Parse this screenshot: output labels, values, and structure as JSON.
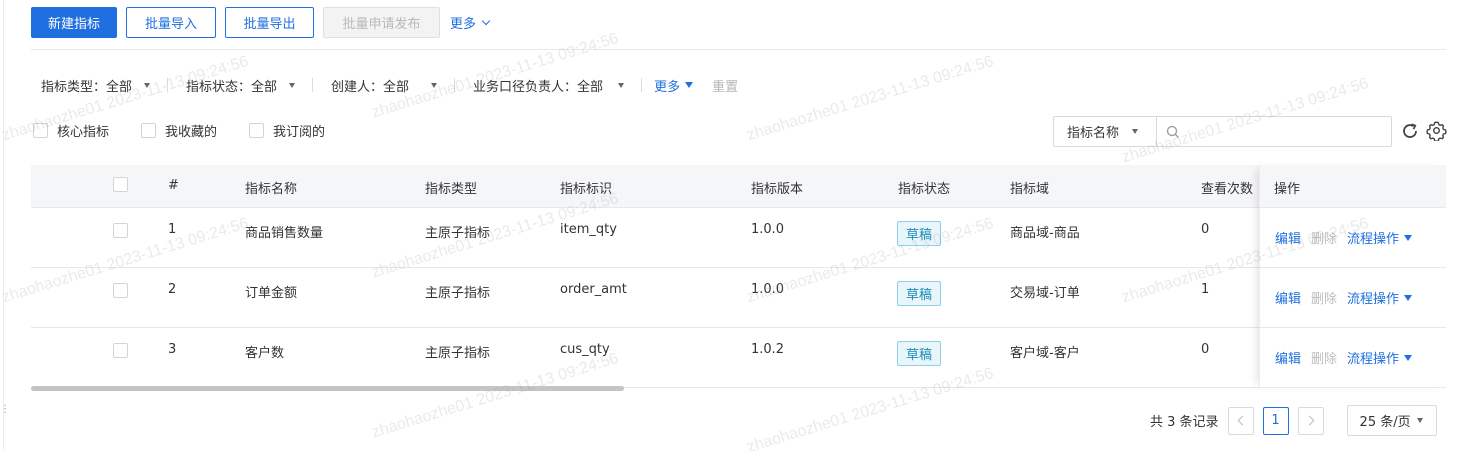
{
  "toolbar": {
    "new_metric": "新建指标",
    "batch_import": "批量导入",
    "batch_export": "批量导出",
    "batch_publish": "批量申请发布",
    "more": "更多"
  },
  "filters": {
    "metric_type": "指标类型：全部",
    "metric_status": "指标状态：全部",
    "creator": "创建人：全部",
    "owner": "业务口径负责人：全部",
    "more": "更多",
    "reset": "重置"
  },
  "quick_checks": {
    "core": "核心指标",
    "favorites": "我收藏的",
    "subscribed": "我订阅的"
  },
  "search": {
    "field": "指标名称",
    "placeholder": ""
  },
  "table": {
    "headers": {
      "index": "#",
      "name": "指标名称",
      "type": "指标类型",
      "code": "指标标识",
      "version": "指标版本",
      "status": "指标状态",
      "domain": "指标域",
      "views": "查看次数",
      "actions": "操作"
    },
    "rows": [
      {
        "index": "1",
        "name": "商品销售数量",
        "type": "主原子指标",
        "code": "item_qty",
        "version": "1.0.0",
        "status": "草稿",
        "domain": "商品域-商品",
        "views": "0"
      },
      {
        "index": "2",
        "name": "订单金额",
        "type": "主原子指标",
        "code": "order_amt",
        "version": "1.0.0",
        "status": "草稿",
        "domain": "交易域-订单",
        "views": "1"
      },
      {
        "index": "3",
        "name": "客户数",
        "type": "主原子指标",
        "code": "cus_qty",
        "version": "1.0.2",
        "status": "草稿",
        "domain": "客户域-客户",
        "views": "0"
      }
    ],
    "actions": {
      "edit": "编辑",
      "delete": "删除",
      "workflow": "流程操作"
    }
  },
  "pagination": {
    "total": "共 3 条记录",
    "current_page": "1",
    "page_size": "25 条/页"
  },
  "watermark": "zhaohaozhe01 2023-11-13 09:24:56",
  "colors": {
    "primary": "#1f6fe0",
    "status_tag": "#1a8cb5"
  }
}
